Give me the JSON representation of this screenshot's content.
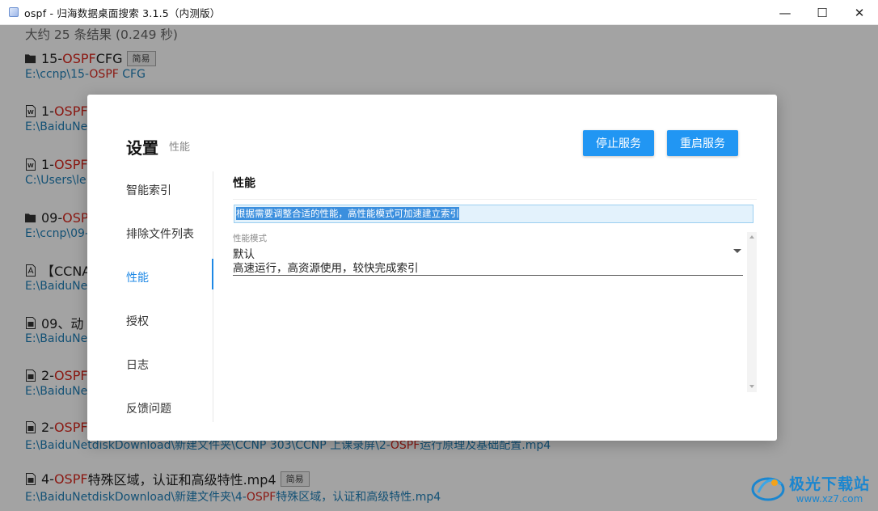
{
  "window": {
    "title": "ospf - 归海数据桌面搜索 3.1.5（内测版）",
    "minimize": "—",
    "maximize": "☐",
    "close": "✕"
  },
  "results": {
    "summary": "大约 25 条结果 (0.249 秒)",
    "items": [
      {
        "icon": "folder-icon",
        "pre": "15-",
        "hl": "OSPF",
        "post": " CFG",
        "tag": "简易",
        "path_pre": "E:\\ccnp\\15-",
        "path_hl": "OSPF",
        "path_post": " CFG"
      },
      {
        "icon": "word-doc-icon",
        "pre": "1-",
        "hl": "OSPF",
        "post": "",
        "tag": "",
        "path_pre": "E:\\BaiduNe",
        "path_hl": "",
        "path_post": ""
      },
      {
        "icon": "word-doc-icon",
        "pre": "1-",
        "hl": "OSPF",
        "post": "",
        "tag": "",
        "path_pre": "C:\\Users\\le",
        "path_hl": "",
        "path_post": ""
      },
      {
        "icon": "folder-icon",
        "pre": "09-",
        "hl": "OSPF",
        "post": "",
        "tag": "",
        "path_pre": "E:\\ccnp\\09-",
        "path_hl": "",
        "path_post": ""
      },
      {
        "icon": "pdf-icon",
        "pre": "【CCNA",
        "hl": "",
        "post": "",
        "tag": "",
        "path_pre": "E:\\BaiduNe",
        "path_hl": "",
        "path_post": ""
      },
      {
        "icon": "video-file-icon",
        "pre": "09、动",
        "hl": "",
        "post": "",
        "tag": "",
        "path_pre": "E:\\BaiduNe",
        "path_hl": "",
        "path_post": ""
      },
      {
        "icon": "video-file-icon",
        "pre": "2-",
        "hl": "OSPF",
        "post": "",
        "tag": "",
        "path_pre": "E:\\BaiduNe",
        "path_hl": "",
        "path_post": ""
      },
      {
        "icon": "video-file-icon",
        "pre": "2-",
        "hl": "OSPF",
        "post": "",
        "tag": "",
        "path_pre": "E:\\BaiduNetdiskDownload\\新建文件夹\\CCNP 303\\CCNP 上课录屏\\2-",
        "path_hl": "OSPF",
        "path_post": "运行原理及基础配置.mp4"
      },
      {
        "icon": "video-file-icon",
        "pre": "4-",
        "hl": "OSPF",
        "post": "特殊区域，认证和高级特性.mp4",
        "tag": "简易",
        "path_pre": "E:\\BaiduNetdiskDownload\\新建文件夹\\4-",
        "path_hl": "OSPF",
        "path_post": "特殊区域，认证和高级特性.mp4"
      }
    ]
  },
  "dialog": {
    "title": "设置",
    "subtitle": "性能",
    "stop_button": "停止服务",
    "restart_button": "重启服务",
    "nav": [
      "智能索引",
      "排除文件列表",
      "性能",
      "授权",
      "日志",
      "反馈问题"
    ],
    "active_nav": "性能",
    "section_title": "性能",
    "info_text": "根据需要调整合适的性能，高性能模式可加速建立索引",
    "field": {
      "label": "性能模式",
      "value": "默认",
      "description": "高速运行，高资源使用，较快完成索引"
    }
  },
  "watermark": {
    "brand": "极光下载站",
    "url": "www.xz7.com"
  },
  "colors": {
    "accent": "#2196f3",
    "highlight": "#d9281e",
    "path": "#1f7fb8"
  }
}
